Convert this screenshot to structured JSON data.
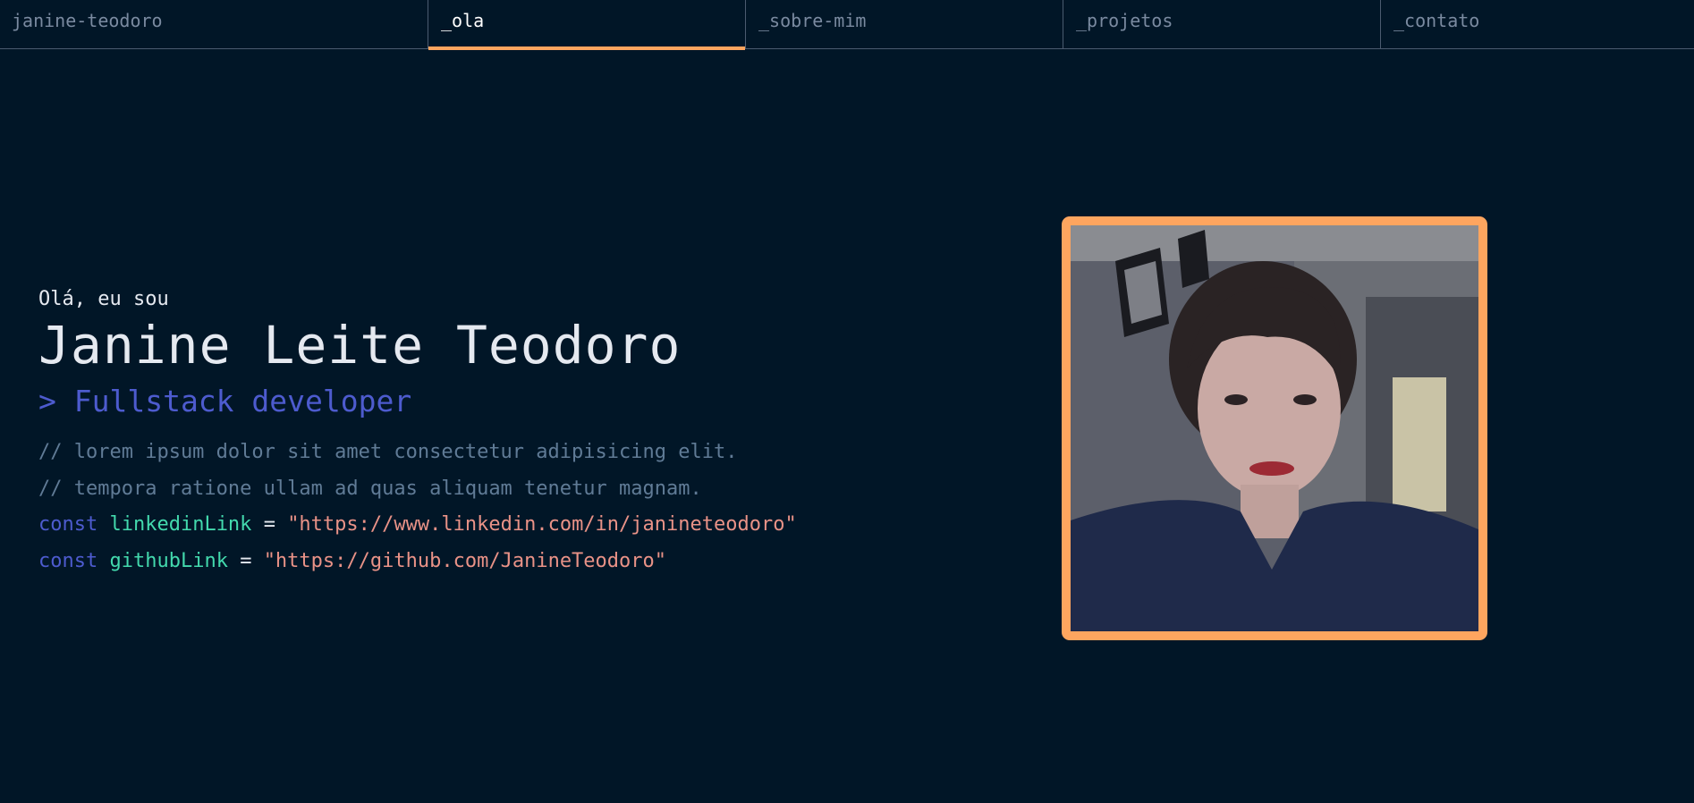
{
  "nav": {
    "brand": "janine-teodoro",
    "tabs": [
      {
        "label": "_ola",
        "active": true
      },
      {
        "label": "_sobre-mim",
        "active": false
      },
      {
        "label": "_projetos",
        "active": false
      },
      {
        "label": "_contato",
        "active": false
      }
    ]
  },
  "hero": {
    "greeting": "Olá, eu sou",
    "name": "Janine Leite Teodoro",
    "role": "> Fullstack developer",
    "comments": [
      "// lorem ipsum dolor sit amet consectetur adipisicing elit.",
      "// tempora ratione ullam ad quas aliquam tenetur magnam."
    ],
    "links": [
      {
        "keyword": "const",
        "name": "linkedinLink",
        "operator": "=",
        "value": "\"https://www.linkedin.com/in/janineteodoro\""
      },
      {
        "keyword": "const",
        "name": "githubLink",
        "operator": "=",
        "value": "\"https://github.com/JanineTeodoro\""
      }
    ]
  },
  "colors": {
    "background": "#011627",
    "accent": "#fea55f",
    "keyword": "#4d5bce",
    "variable": "#43d9ad",
    "string": "#e99287",
    "comment": "#607b96"
  },
  "photo": {
    "icon": "profile-photo"
  }
}
